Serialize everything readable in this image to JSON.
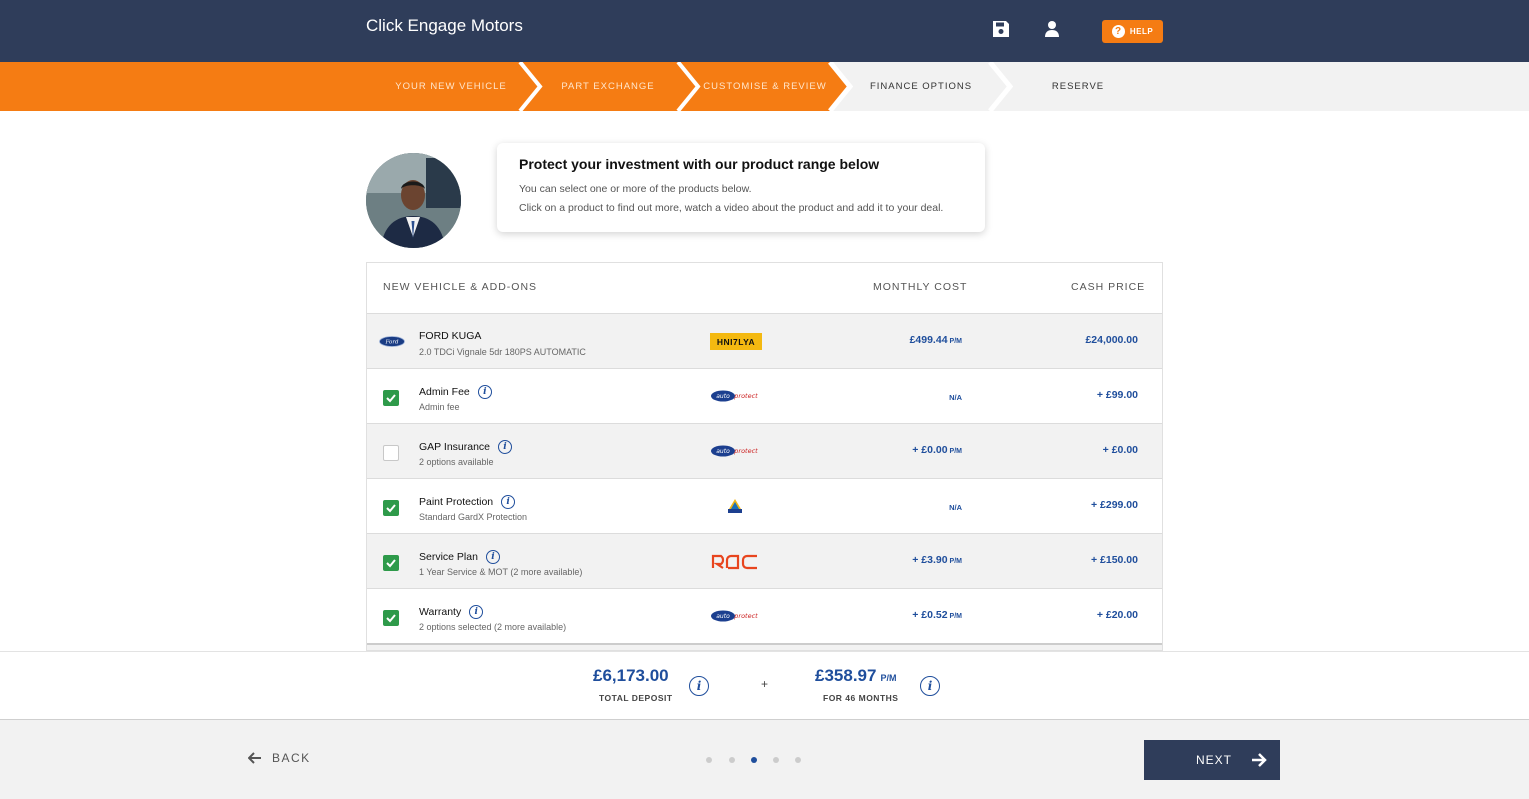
{
  "header": {
    "brand": "Click Engage Motors",
    "help_label": "HELP",
    "icons": [
      "save-icon",
      "user-icon"
    ]
  },
  "steps": [
    {
      "label": "YOUR NEW VEHICLE",
      "state": "done"
    },
    {
      "label": "PART EXCHANGE",
      "state": "done"
    },
    {
      "label": "CUSTOMISE & REVIEW",
      "state": "current"
    },
    {
      "label": "FINANCE OPTIONS",
      "state": "todo"
    },
    {
      "label": "RESERVE",
      "state": "todo"
    }
  ],
  "advisor": {
    "title": "Protect your investment with our product range below",
    "line1": "You can select one or more of the products below.",
    "line2": "Click on a product to find out more, watch a video about the product and add it to your deal."
  },
  "table": {
    "headers": {
      "item": "NEW VEHICLE & ADD-ONS",
      "monthly": "MONTHLY COST",
      "cash": "CASH PRICE"
    },
    "vehicle": {
      "name": "FORD KUGA",
      "spec": "2.0 TDCi Vignale 5dr 180PS AUTOMATIC",
      "plate": "HNI7LYA",
      "monthly": "£499.44",
      "pm": "P/M",
      "cash": "£24,000.00"
    },
    "addons": [
      {
        "title": "Admin Fee",
        "sub": "Admin fee",
        "checked": true,
        "provider": "autoprotect",
        "monthly": "N/A",
        "pm": "",
        "cash": "+ £99.00"
      },
      {
        "title": "GAP Insurance",
        "sub": "2 options available",
        "checked": false,
        "provider": "autoprotect",
        "monthly": "+ £0.00",
        "pm": "P/M",
        "cash": "+ £0.00"
      },
      {
        "title": "Paint Protection",
        "sub": "Standard GardX Protection",
        "checked": true,
        "provider": "gardx",
        "monthly": "N/A",
        "pm": "",
        "cash": "+ £299.00"
      },
      {
        "title": "Service Plan",
        "sub": "1 Year Service & MOT (2 more available)",
        "checked": true,
        "provider": "rac",
        "monthly": "+ £3.90",
        "pm": "P/M",
        "cash": "+ £150.00"
      },
      {
        "title": "Warranty",
        "sub": "2 options selected (2 more available)",
        "checked": true,
        "provider": "autoprotect",
        "monthly": "+ £0.52",
        "pm": "P/M",
        "cash": "+ £20.00"
      }
    ]
  },
  "totals": {
    "deposit_value": "£6,173.00",
    "deposit_label": "TOTAL DEPOSIT",
    "plus": "+",
    "monthly_value": "£358.97",
    "monthly_pm": "P/M",
    "monthly_label": "FOR 46 MONTHS"
  },
  "footer": {
    "back_label": "BACK",
    "next_label": "NEXT",
    "pager_count": 5,
    "pager_active": 3
  },
  "colors": {
    "navy": "#2f3d5a",
    "orange": "#f57c13",
    "accent_blue": "#1f4e9c",
    "check_green": "#2e9a4a",
    "plate_yellow": "#f4b911"
  }
}
